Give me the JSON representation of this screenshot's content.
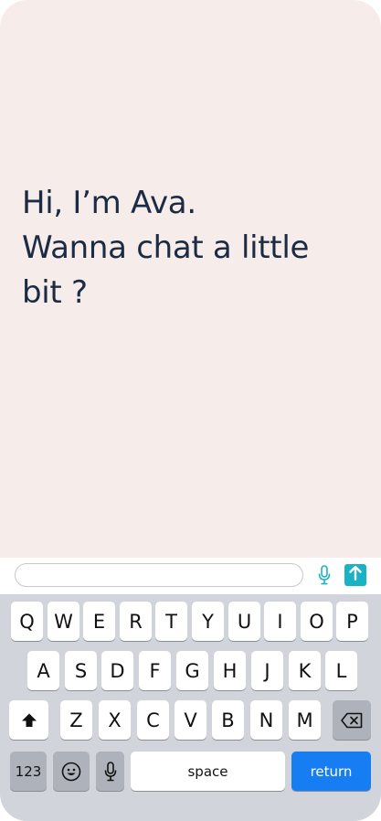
{
  "greeting": {
    "line1": "Hi, I’m Ava.",
    "line2": "Wanna chat a little",
    "line3": "bit ?"
  },
  "input": {
    "value": "",
    "placeholder": ""
  },
  "colors": {
    "background": "#f6edea",
    "text": "#1b2b44",
    "accent": "#19b3c4",
    "keyboard": "#d1d4da",
    "return_key": "#167ef2"
  },
  "keyboard": {
    "row1": [
      "Q",
      "W",
      "E",
      "R",
      "T",
      "Y",
      "U",
      "I",
      "O",
      "P"
    ],
    "row2": [
      "A",
      "S",
      "D",
      "F",
      "G",
      "H",
      "J",
      "K",
      "L"
    ],
    "row3": [
      "Z",
      "X",
      "C",
      "V",
      "B",
      "N",
      "M"
    ],
    "numbers_label": "123",
    "space_label": "space",
    "return_label": "return"
  },
  "icons": {
    "mic": "microphone-icon",
    "send": "arrow-up-icon",
    "shift": "shift-arrow-icon",
    "backspace": "backspace-icon",
    "emoji": "emoji-face-icon",
    "dictation": "microphone-icon"
  }
}
